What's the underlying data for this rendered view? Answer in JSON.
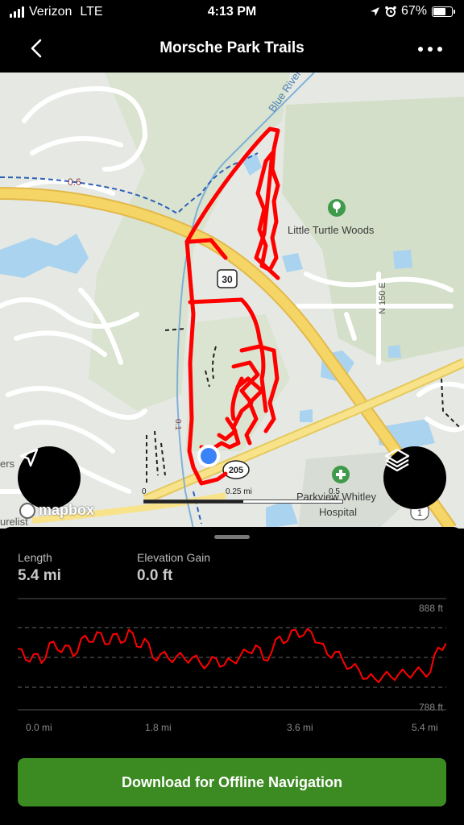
{
  "status_bar": {
    "carrier": "Verizon",
    "network": "LTE",
    "time": "4:13 PM",
    "battery": "67%",
    "battery_level": 0.67
  },
  "header": {
    "title": "Morsche Park Trails",
    "back_icon": "chevron-left-icon",
    "more_icon": "ellipsis-icon"
  },
  "map": {
    "labels": {
      "river": "Blue River",
      "poi_woods": "Little Turtle Woods",
      "road_n150e": "N 150 E",
      "route_30": "30",
      "route_205": "205",
      "dashed_distance": "0.6",
      "hospital_line1": "Parkview Whitley",
      "hospital_line2": "Hospital",
      "side_text": "ers",
      "bottom_text": "urelist",
      "trail_number": "0.1",
      "route_badge_right": "1"
    },
    "scale": {
      "zero": "0",
      "mid": "0.25 mi",
      "end": "0.5 mi"
    },
    "attribution": "mapbox",
    "colors": {
      "track": "#ff0000",
      "road": "#f3cf57",
      "water": "#a9d3ee",
      "park": "#d2dfc7",
      "location": "#3a82f7"
    }
  },
  "stats": {
    "length_label": "Length",
    "length_value": "5.4 mi",
    "elevation_label": "Elevation Gain",
    "elevation_value": "0.0 ft"
  },
  "chart_data": {
    "type": "line",
    "title": "",
    "xlabel": "",
    "ylabel": "",
    "ylim_labels": {
      "max": "888 ft",
      "min": "788 ft"
    },
    "ylim": [
      788,
      888
    ],
    "xlim": [
      0,
      5.4
    ],
    "x_ticks": [
      "0.0 mi",
      "1.8 mi",
      "3.6 mi",
      "5.4 mi"
    ],
    "x_tick_values": [
      0.0,
      1.8,
      3.6,
      5.4
    ],
    "series": [
      {
        "color": "#ff0000",
        "x": [
          0.0,
          0.1,
          0.2,
          0.3,
          0.4,
          0.5,
          0.6,
          0.7,
          0.8,
          0.9,
          1.0,
          1.1,
          1.2,
          1.3,
          1.4,
          1.5,
          1.6,
          1.7,
          1.8,
          1.9,
          2.0,
          2.1,
          2.2,
          2.3,
          2.4,
          2.5,
          2.6,
          2.7,
          2.8,
          2.9,
          3.0,
          3.1,
          3.2,
          3.3,
          3.4,
          3.5,
          3.6,
          3.7,
          3.8,
          3.9,
          4.0,
          4.1,
          4.2,
          4.3,
          4.4,
          4.5,
          4.6,
          4.7,
          4.8,
          4.9,
          5.0,
          5.1,
          5.2,
          5.3,
          5.4
        ],
        "y": [
          843,
          833,
          838,
          830,
          848,
          842,
          846,
          836,
          852,
          849,
          858,
          847,
          856,
          848,
          860,
          845,
          852,
          835,
          838,
          834,
          836,
          834,
          835,
          830,
          829,
          834,
          828,
          832,
          836,
          840,
          846,
          833,
          840,
          854,
          850,
          860,
          855,
          858,
          848,
          838,
          840,
          832,
          826,
          824,
          816,
          816,
          818,
          818,
          820,
          820,
          822,
          822,
          822,
          844,
          848
        ]
      }
    ]
  },
  "download_button": "Download for Offline Navigation"
}
